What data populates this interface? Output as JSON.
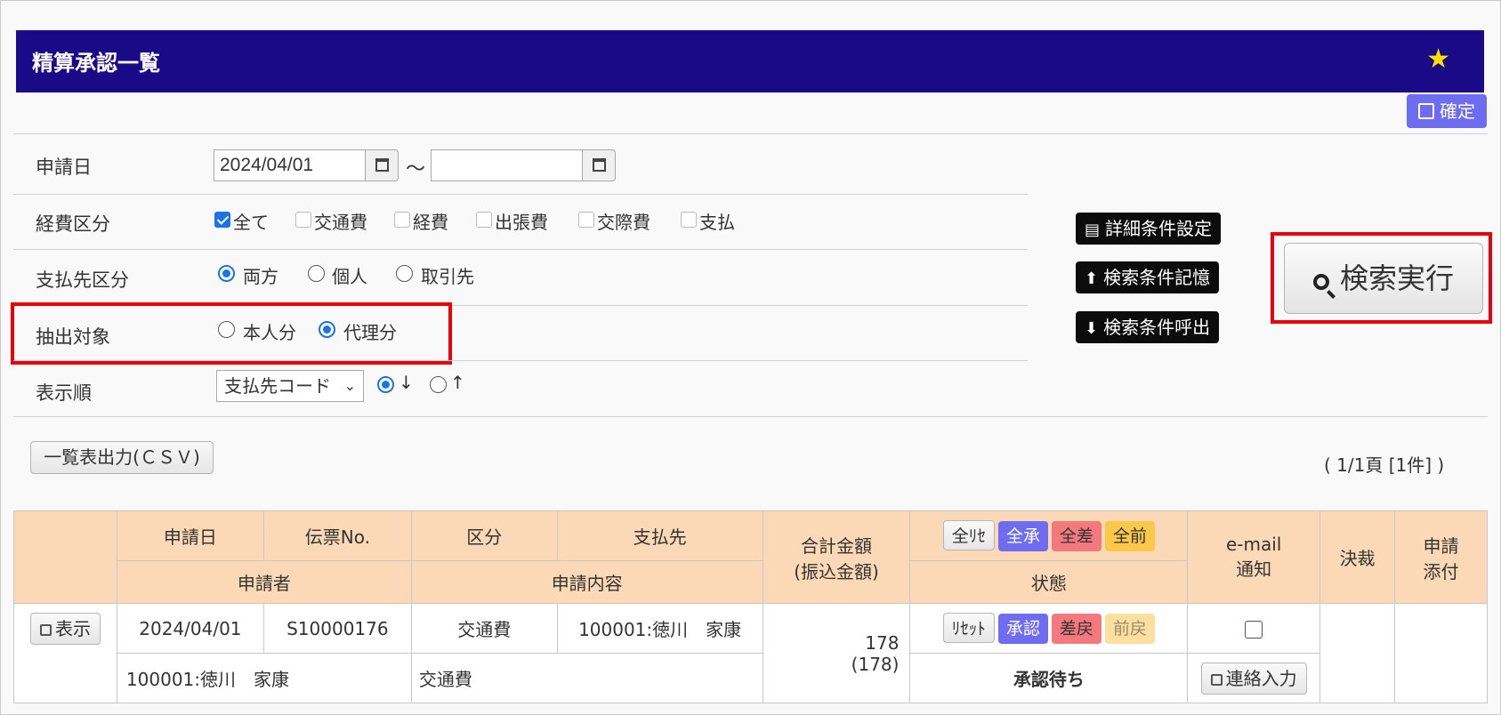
{
  "header": {
    "title": "精算承認一覧",
    "star_icon": "star-icon"
  },
  "toolbar": {
    "confirm_label": "確定"
  },
  "filters": {
    "apply_date": {
      "label": "申請日",
      "from_value": "2024/04/01",
      "to_value": "",
      "separator": "～"
    },
    "expense_type": {
      "label": "経費区分",
      "options": [
        {
          "label": "全て",
          "checked": true
        },
        {
          "label": "交通費",
          "checked": false
        },
        {
          "label": "経費",
          "checked": false
        },
        {
          "label": "出張費",
          "checked": false
        },
        {
          "label": "交際費",
          "checked": false
        },
        {
          "label": "支払",
          "checked": false
        }
      ]
    },
    "payee_type": {
      "label": "支払先区分",
      "options": [
        {
          "label": "両方",
          "selected": true
        },
        {
          "label": "個人",
          "selected": false
        },
        {
          "label": "取引先",
          "selected": false
        }
      ]
    },
    "extract_target": {
      "label": "抽出対象",
      "options": [
        {
          "label": "本人分",
          "selected": false
        },
        {
          "label": "代理分",
          "selected": true
        }
      ]
    },
    "sort_order": {
      "label": "表示順",
      "selected": "支払先コード",
      "directions": [
        {
          "label": "↓",
          "selected": true
        },
        {
          "label": "↑",
          "selected": false
        }
      ]
    }
  },
  "side_buttons": {
    "detail_conditions": "詳細条件設定",
    "save_conditions": "検索条件記憶",
    "load_conditions": "検索条件呼出",
    "search": "検索実行"
  },
  "list": {
    "csv_button": "一覧表出力(ＣＳＶ)",
    "pager": "( 1/1頁 [1件] )",
    "headers": {
      "apply_date": "申請日",
      "slip_no": "伝票No.",
      "category": "区分",
      "payee": "支払先",
      "applicant": "申請者",
      "content": "申請内容",
      "total_line1": "合計金額",
      "total_line2": "(振込金額)",
      "reset_all": "全ﾘｾ",
      "approve_all": "全承",
      "reject_all": "全差",
      "return_all": "全前",
      "status": "状態",
      "email_line1": "e-mail",
      "email_line2": "通知",
      "decision": "決裁",
      "attach_line1": "申請",
      "attach_line2": "添付"
    },
    "rows": [
      {
        "show_button": "表示",
        "apply_date": "2024/04/01",
        "slip_no": "S10000176",
        "category": "交通費",
        "payee": "100001:徳川　家康",
        "applicant": "100001:徳川　家康",
        "content": "交通費",
        "total": "178",
        "transfer": "(178)",
        "reset": "ﾘｾｯﾄ",
        "approve": "承認",
        "reject": "差戻",
        "return": "前戻",
        "status": "承認待ち",
        "contact_button": "連絡入力"
      }
    ]
  },
  "colors": {
    "title_bar": "#1a0a88",
    "accent_blue": "#6e6cf0",
    "header_fill": "#fcd9b6",
    "highlight": "#e8000a"
  }
}
